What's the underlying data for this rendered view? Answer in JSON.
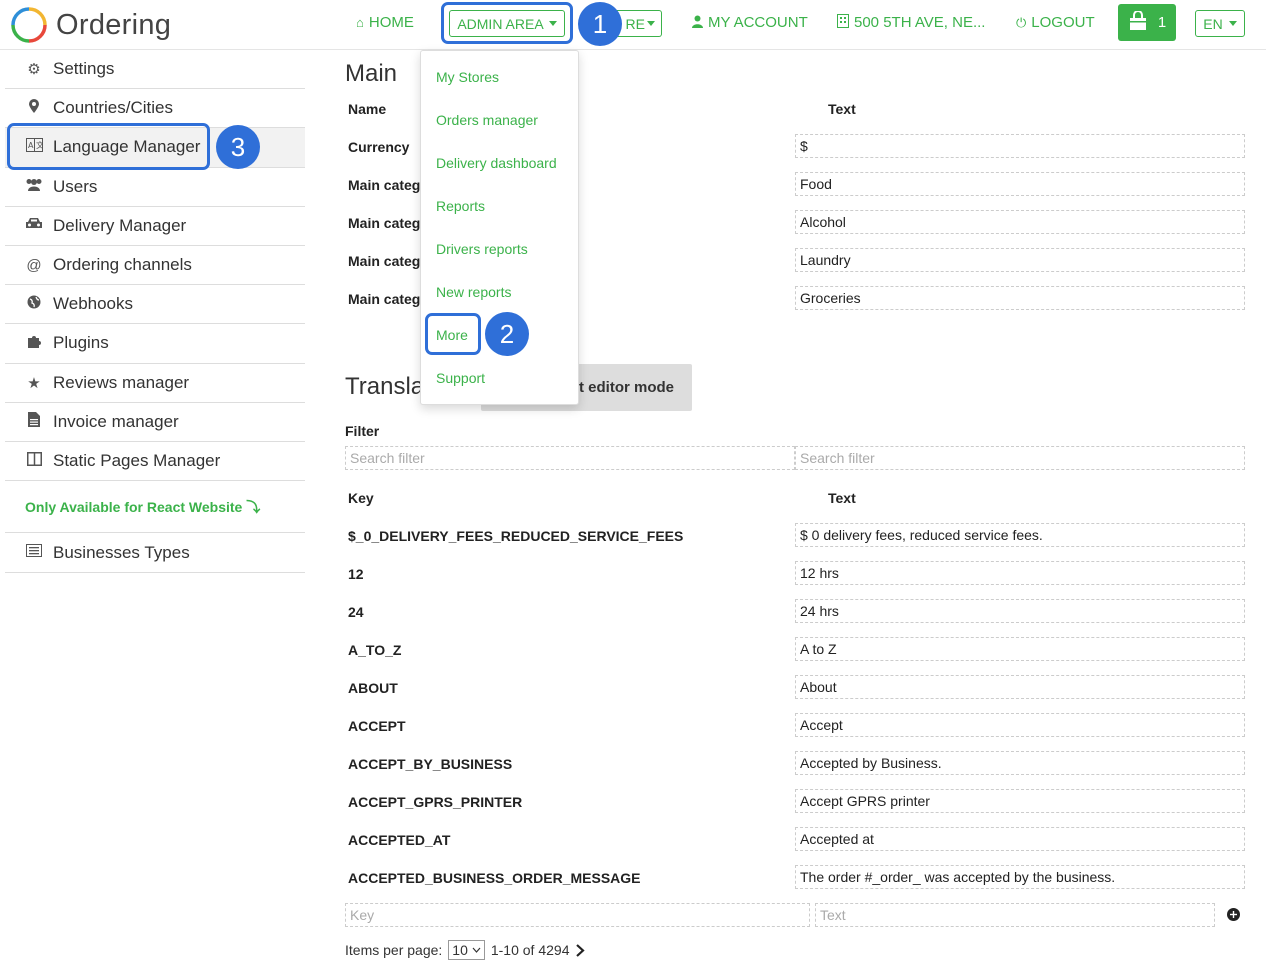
{
  "header": {
    "app_name": "Ordering",
    "nav": {
      "home": "HOME",
      "admin_area": "ADMIN AREA",
      "more_partial": "RE",
      "my_account": "MY ACCOUNT",
      "address": "500 5TH AVE, NE...",
      "logout": "LOGOUT",
      "cart_count": "1",
      "language": "EN"
    }
  },
  "annotations": {
    "badge1": "1",
    "badge2": "2",
    "badge3": "3"
  },
  "dropdown": {
    "items": [
      "My Stores",
      "Orders manager",
      "Delivery dashboard",
      "Reports",
      "Drivers reports",
      "New reports",
      "More",
      "Support"
    ]
  },
  "sidebar": {
    "items": [
      {
        "label": "Settings",
        "icon": "gear-icon"
      },
      {
        "label": "Countries/Cities",
        "icon": "map-marker-icon"
      },
      {
        "label": "Language Manager",
        "icon": "language-icon"
      },
      {
        "label": "Users",
        "icon": "users-icon"
      },
      {
        "label": "Delivery Manager",
        "icon": "car-icon"
      },
      {
        "label": "Ordering channels",
        "icon": "at-icon"
      },
      {
        "label": "Webhooks",
        "icon": "globe-icon"
      },
      {
        "label": "Plugins",
        "icon": "puzzle-icon"
      },
      {
        "label": "Reviews manager",
        "icon": "star-icon"
      },
      {
        "label": "Invoice manager",
        "icon": "file-icon"
      },
      {
        "label": "Static Pages Manager",
        "icon": "columns-icon"
      }
    ],
    "react_note": "Only Available for React Website ⤵",
    "businesses_types": "Businesses Types"
  },
  "main": {
    "title": "Main",
    "name_header": "Name",
    "text_header": "Text",
    "rows": [
      {
        "name": "Currency",
        "text": "$"
      },
      {
        "name": "Main categ",
        "text": "Food"
      },
      {
        "name": "Main categ",
        "text": "Alcohol"
      },
      {
        "name": "Main categ",
        "text": "Laundry"
      },
      {
        "name": "Main categ",
        "text": "Groceries"
      }
    ]
  },
  "translations": {
    "title_partial": "Transla",
    "toggle_partial": "t editor mode",
    "filter_label": "Filter",
    "filter_placeholder": "Search filter",
    "key_header": "Key",
    "text_header": "Text",
    "rows": [
      {
        "key": "$_0_DELIVERY_FEES_REDUCED_SERVICE_FEES",
        "text": "$ 0 delivery fees, reduced service fees."
      },
      {
        "key": "12",
        "text": "12 hrs"
      },
      {
        "key": "24",
        "text": "24 hrs"
      },
      {
        "key": "A_TO_Z",
        "text": "A to Z"
      },
      {
        "key": "ABOUT",
        "text": "About"
      },
      {
        "key": "ACCEPT",
        "text": "Accept"
      },
      {
        "key": "ACCEPT_BY_BUSINESS",
        "text": "Accepted by Business."
      },
      {
        "key": "ACCEPT_GPRS_PRINTER",
        "text": "Accept GPRS printer"
      },
      {
        "key": "ACCEPTED_AT",
        "text": "Accepted at"
      },
      {
        "key": "ACCEPTED_BUSINESS_ORDER_MESSAGE",
        "text": "The order #_order_ was accepted by the business."
      }
    ],
    "new_key_placeholder": "Key",
    "new_text_placeholder": "Text"
  },
  "pagination": {
    "label": "Items per page:",
    "per_page": "10",
    "range": "1-10 of 4294"
  },
  "colors": {
    "accent": "#3bb24a",
    "annotation": "#2f6fd8"
  }
}
